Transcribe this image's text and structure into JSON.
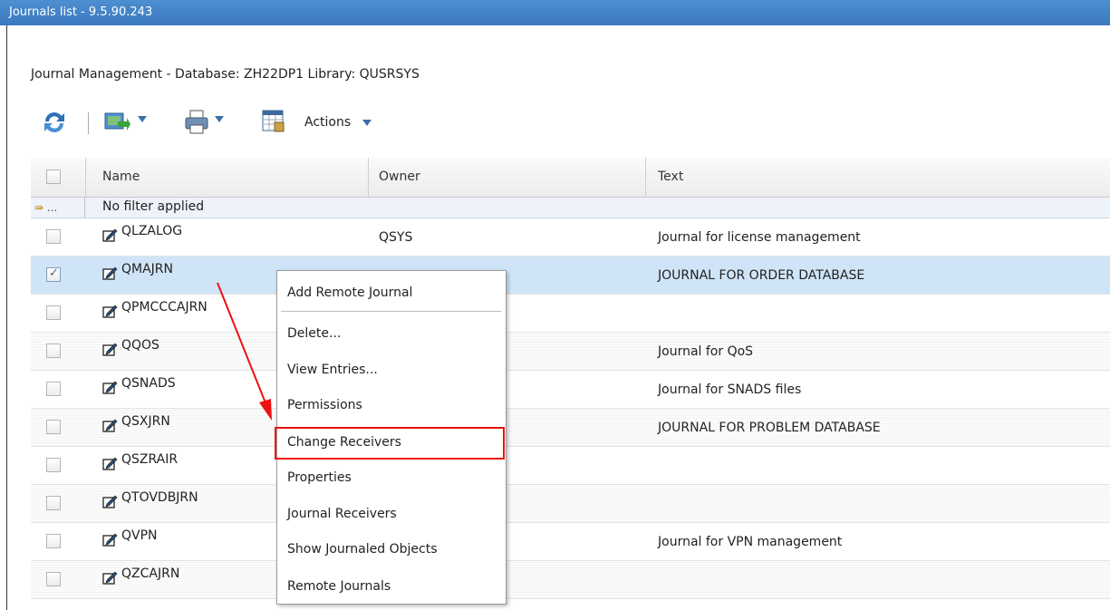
{
  "window": {
    "title": "Journals list - 9.5.90.243"
  },
  "heading": "Journal Management - Database: ZH22DP1 Library: QUSRSYS",
  "toolbar": {
    "actions_label": "Actions"
  },
  "table": {
    "columns": [
      "Name",
      "Owner",
      "Text"
    ],
    "filter_text": "No filter applied",
    "filter_icon": "...",
    "rows": [
      {
        "name": "QLZALOG",
        "owner": "QSYS",
        "text": "Journal for license management",
        "checked": false
      },
      {
        "name": "QMAJRN",
        "owner": "",
        "text": "JOURNAL FOR ORDER DATABASE",
        "checked": true
      },
      {
        "name": "QPMCCCAJRN",
        "owner": "",
        "text": "",
        "checked": false
      },
      {
        "name": "QQOS",
        "owner": "",
        "text": "Journal for QoS",
        "checked": false
      },
      {
        "name": "QSNADS",
        "owner": "",
        "text": "Journal for SNADS files",
        "checked": false
      },
      {
        "name": "QSXJRN",
        "owner": "",
        "text": "JOURNAL FOR PROBLEM DATABASE",
        "checked": false
      },
      {
        "name": "QSZRAIR",
        "owner": "",
        "text": "",
        "checked": false
      },
      {
        "name": "QTOVDBJRN",
        "owner": "",
        "text": "",
        "checked": false
      },
      {
        "name": "QVPN",
        "owner": "",
        "text": "Journal for VPN management",
        "checked": false
      },
      {
        "name": "QZCAJRN",
        "owner": "",
        "text": "",
        "checked": false
      }
    ]
  },
  "context_menu": {
    "items": [
      "Add Remote Journal",
      "Delete...",
      "View Entries...",
      "Permissions",
      "Change Receivers",
      "Properties",
      "Journal Receivers",
      "Show Journaled Objects",
      "Remote Journals"
    ],
    "highlighted": "Change Receivers"
  },
  "colors": {
    "titlebar": "#3a78bf",
    "selected_row": "#cfe5f7",
    "annotation": "#e11111"
  }
}
